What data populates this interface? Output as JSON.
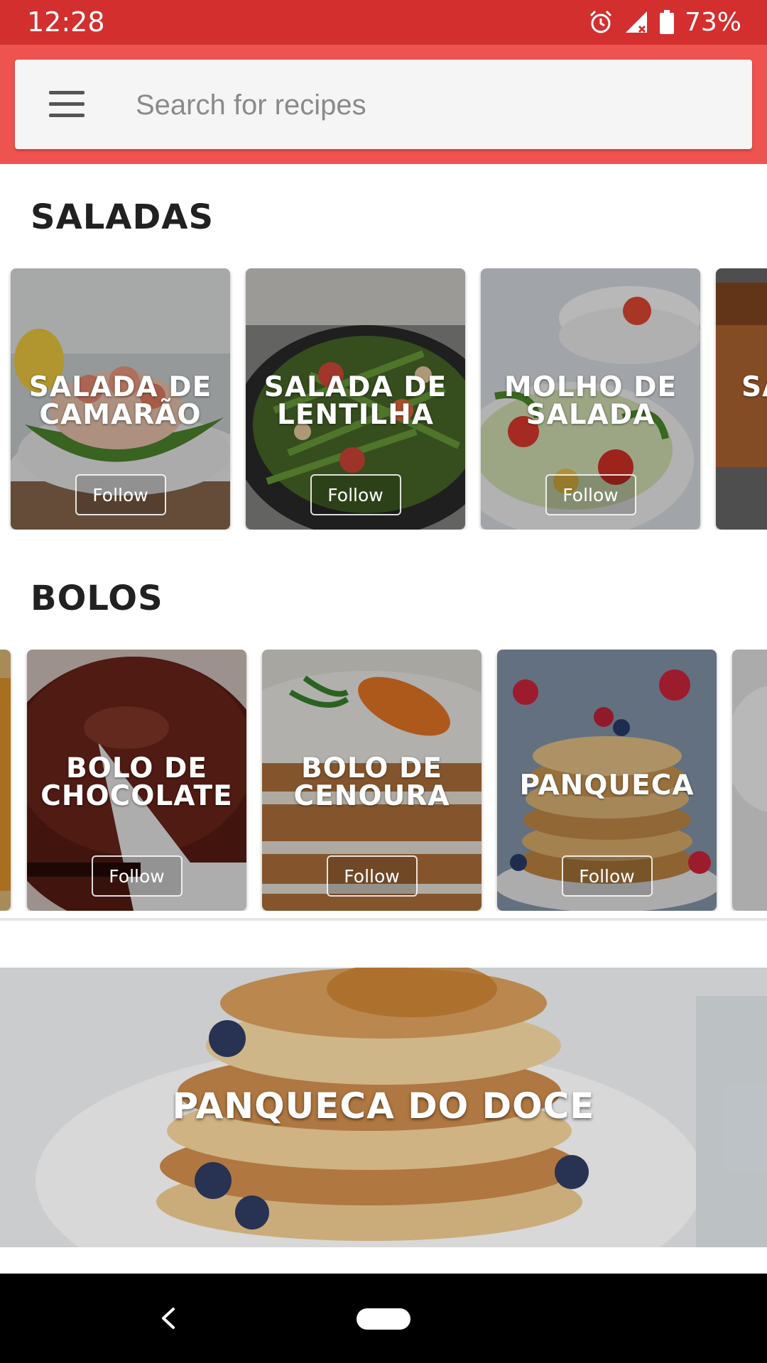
{
  "status_bar": {
    "time": "12:28",
    "battery": "73%",
    "icons": [
      "alarm-icon",
      "signal-icon",
      "battery-icon"
    ]
  },
  "search": {
    "placeholder": "Search for recipes",
    "value": ""
  },
  "sections": [
    {
      "title": "SALADAS",
      "cards": [
        {
          "title": "SALADA DE CAMARÃO",
          "follow": "Follow"
        },
        {
          "title": "SALADA DE LENTILHA",
          "follow": "Follow"
        },
        {
          "title": "MOLHO DE SALADA",
          "follow": "Follow"
        },
        {
          "title": "SA",
          "follow": ""
        }
      ]
    },
    {
      "title": "BOLOS",
      "cards": [
        {
          "title": "BOLO DE CHOCOLATE",
          "follow": "Follow"
        },
        {
          "title": "BOLO DE CENOURA",
          "follow": "Follow"
        },
        {
          "title": "PANQUECA",
          "follow": "Follow"
        }
      ]
    }
  ],
  "featured": {
    "title": "PANQUECA DO DOCE"
  },
  "colors": {
    "status_bar": "#d32f2f",
    "app_bar": "#ef5350",
    "nav_bar": "#000000"
  },
  "icons": {
    "menu": "menu-icon",
    "back": "back-icon",
    "home": "home-pill-icon"
  }
}
